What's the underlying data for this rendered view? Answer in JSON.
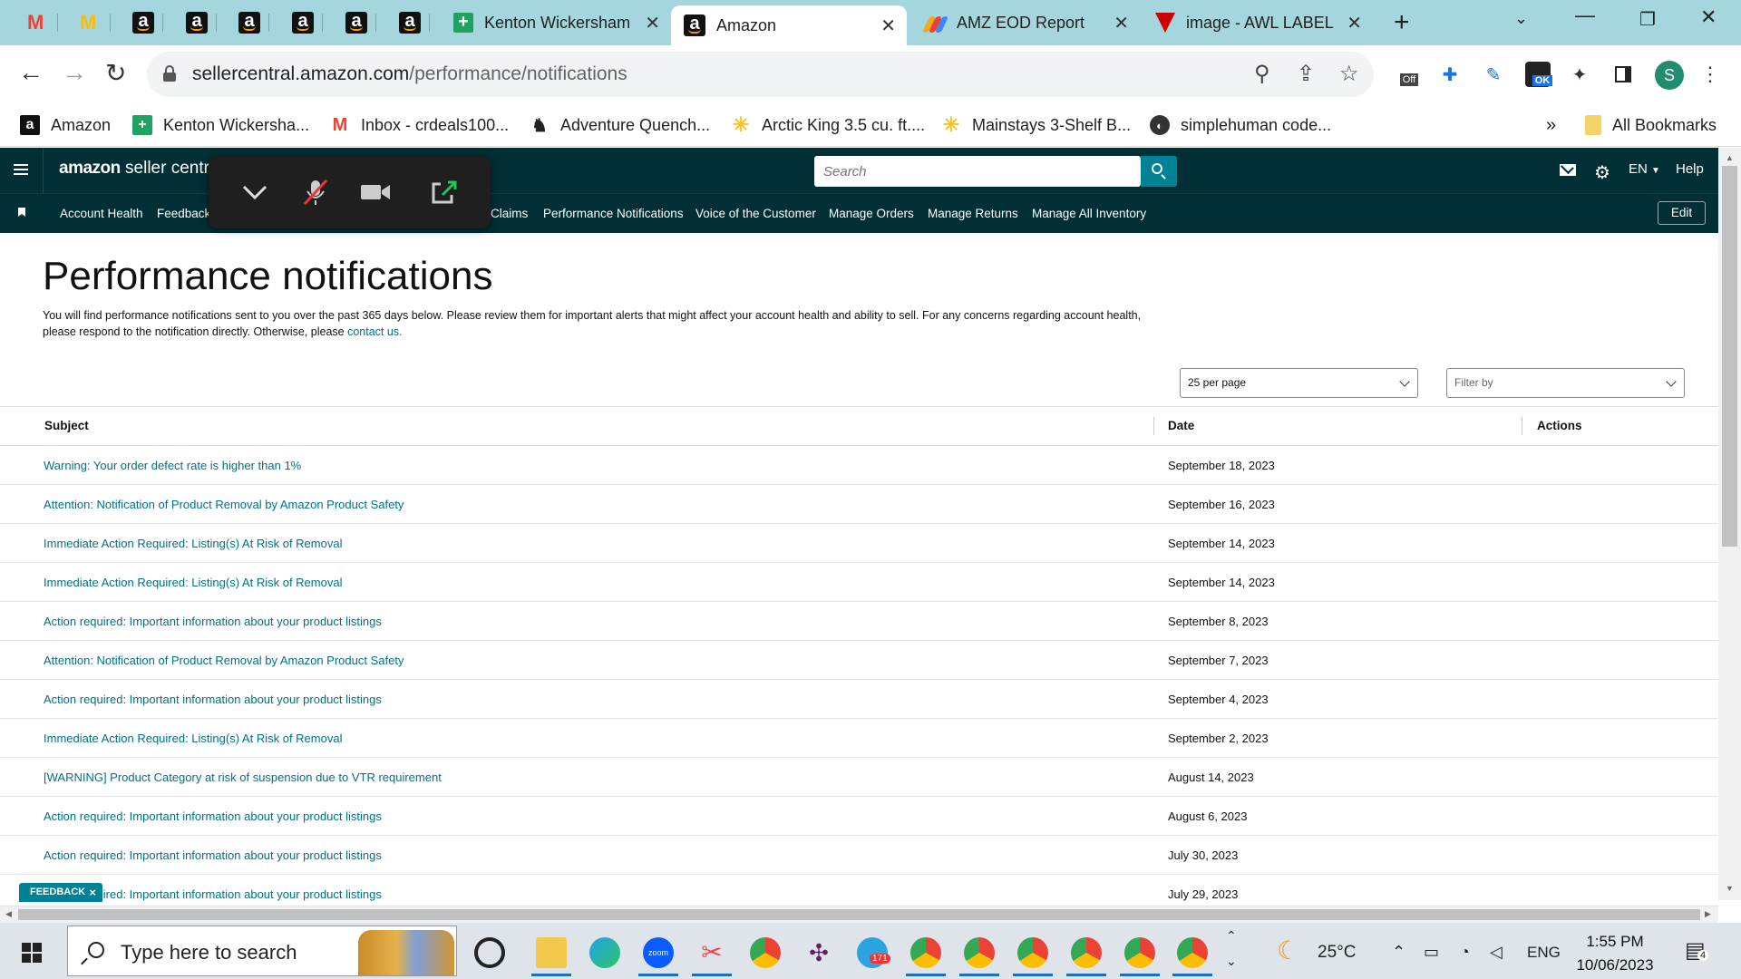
{
  "browser": {
    "pinned_tabs": [
      "gmail",
      "gmail",
      "amazon",
      "amazon",
      "amazon",
      "amazon",
      "amazon",
      "amazon"
    ],
    "tabs": [
      {
        "title": "Kenton Wickersham",
        "icon": "sheets-icon",
        "active": false
      },
      {
        "title": "Amazon",
        "icon": "amazon-icon",
        "active": true
      },
      {
        "title": "AMZ EOD Report",
        "icon": "report-icon",
        "active": false
      },
      {
        "title": "image - AWL LABEL",
        "icon": "pin-icon",
        "active": false
      }
    ],
    "url_host": "sellercentral.amazon.com",
    "url_path": "/performance/notifications",
    "profile_initial": "S",
    "extension_badges": {
      "off": "Off",
      "ok": "OK"
    },
    "bookmarks": [
      {
        "label": "Amazon",
        "icon": "amazon-icon"
      },
      {
        "label": "Kenton Wickersha...",
        "icon": "sheets-icon"
      },
      {
        "label": "Inbox - crdeals100...",
        "icon": "gmail-icon"
      },
      {
        "label": "Adventure Quench...",
        "icon": "lion-icon"
      },
      {
        "label": "Arctic King 3.5 cu. ft....",
        "icon": "walmart-icon"
      },
      {
        "label": "Mainstays 3-Shelf B...",
        "icon": "walmart-icon"
      },
      {
        "label": "simplehuman code...",
        "icon": "globe-icon"
      }
    ],
    "bookmarks_more": "»",
    "all_bookmarks": "All Bookmarks"
  },
  "seller_central": {
    "logo_brand": "amazon",
    "logo_product": "seller central",
    "search_placeholder": "Search",
    "language": "EN",
    "help": "Help",
    "edit": "Edit",
    "nav": [
      "Account Health",
      "Feedback",
      "Claims",
      "Performance Notifications",
      "Voice of the Customer",
      "Manage Orders",
      "Manage Returns",
      "Manage All Inventory"
    ]
  },
  "page": {
    "title": "Performance notifications",
    "intro": "You will find performance notifications sent to you over the past 365 days below. Please review them for important alerts that might affect your account health and ability to sell. For any concerns regarding account health, please respond to the notification directly. Otherwise, please ",
    "intro_link": "contact us.",
    "per_page": "25 per page",
    "filter_placeholder": "Filter by",
    "columns": {
      "subject": "Subject",
      "date": "Date",
      "actions": "Actions"
    },
    "rows": [
      {
        "subject": "Warning: Your order defect rate is higher than 1%",
        "date": "September 18, 2023"
      },
      {
        "subject": "Attention: Notification of Product Removal by Amazon Product Safety",
        "date": "September 16, 2023"
      },
      {
        "subject": "Immediate Action Required: Listing(s) At Risk of Removal",
        "date": "September 14, 2023"
      },
      {
        "subject": "Immediate Action Required: Listing(s) At Risk of Removal",
        "date": "September 14, 2023"
      },
      {
        "subject": "Action required: Important information about your product listings",
        "date": "September 8, 2023"
      },
      {
        "subject": "Attention: Notification of Product Removal by Amazon Product Safety",
        "date": "September 7, 2023"
      },
      {
        "subject": "Action required: Important information about your product listings",
        "date": "September 4, 2023"
      },
      {
        "subject": "Immediate Action Required: Listing(s) At Risk of Removal",
        "date": "September 2, 2023"
      },
      {
        "subject": "[WARNING] Product Category at risk of suspension due to VTR requirement",
        "date": "August 14, 2023"
      },
      {
        "subject": "Action required: Important information about your product listings",
        "date": "August 6, 2023"
      },
      {
        "subject": "Action required: Important information about your product listings",
        "date": "July 30, 2023"
      },
      {
        "subject": "Action required: Important information about your product listings",
        "date": "July 29, 2023"
      }
    ],
    "feedback": "FEEDBACK",
    "feedback_close": "×"
  },
  "taskbar": {
    "search_placeholder": "Type here to search",
    "telegram_badge": "171",
    "temperature": "25°C",
    "language": "ENG",
    "time": "1:55 PM",
    "date": "10/06/2023",
    "notifications": "4"
  },
  "colors": {
    "tab_strip": "#a5d6dd",
    "sc_header": "#002f36",
    "accent": "#008296",
    "link": "#007185"
  }
}
